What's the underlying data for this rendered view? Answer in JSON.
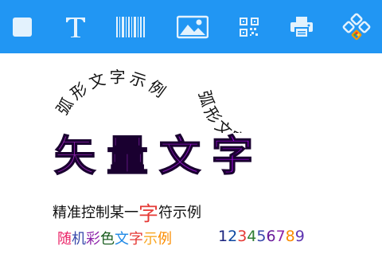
{
  "toolbar": {
    "background": "#2196f3",
    "tools": [
      {
        "icon": "square-icon"
      },
      {
        "icon": "text-icon"
      },
      {
        "icon": "barcode-icon"
      },
      {
        "icon": "image-icon"
      },
      {
        "icon": "qrcode-icon"
      },
      {
        "icon": "printer-icon"
      },
      {
        "icon": "blocks-icon"
      }
    ]
  },
  "canvas": {
    "arc_left": "弧形文字示例",
    "arc_right": "弧形文字示例",
    "vector_title": "矢量文字",
    "vector_gradient": [
      "#8e24aa",
      "#6a1b9a",
      "#b000ff"
    ],
    "precise": {
      "before": "精准控制某一",
      "highlight": "字",
      "after": "符示例",
      "highlight_color": "#e53935"
    },
    "random_color": {
      "chars": [
        "随",
        "机",
        "彩",
        "色",
        "文",
        "字",
        "示",
        "例"
      ],
      "colors": [
        "#e91e63",
        "#3949ab",
        "#8e24aa",
        "#1b5e20",
        "#1e88e5",
        "#e53935",
        "#f9a825",
        "#fb8c00"
      ]
    },
    "digits": {
      "chars": [
        "1",
        "2",
        "3",
        "4",
        "5",
        "6",
        "7",
        "8",
        "9"
      ],
      "colors": [
        "#1a237e",
        "#0d47a1",
        "#e53935",
        "#2e7d32",
        "#3949ab",
        "#6a1b9a",
        "#8e24aa",
        "#fb8c00",
        "#5e35b1"
      ]
    }
  }
}
